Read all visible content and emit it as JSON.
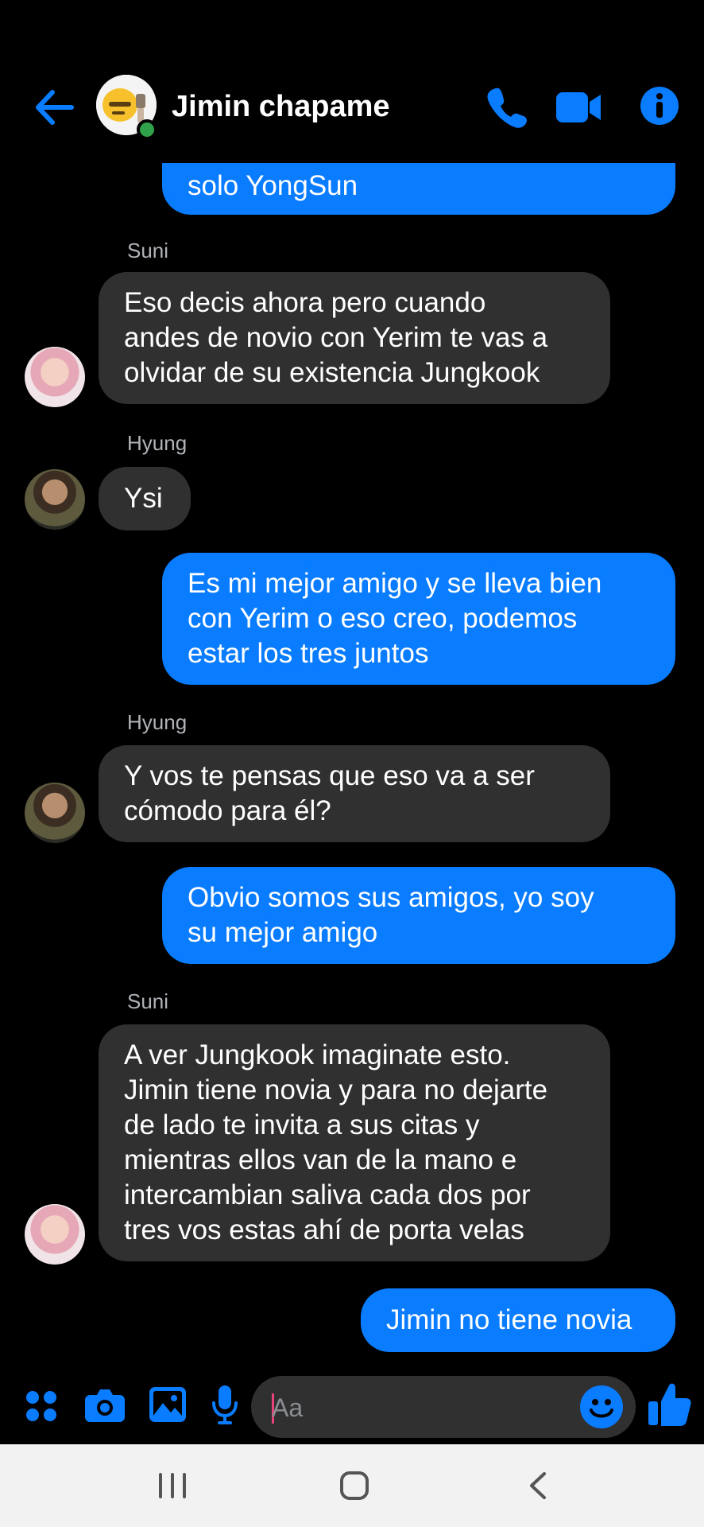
{
  "header": {
    "title": "Jimin chapame"
  },
  "messages": {
    "m0": {
      "text": "solo YongSun"
    },
    "m1": {
      "sender": "Suni",
      "lines": [
        "Eso decis ahora pero cuando",
        "andes de novio con Yerim te vas a",
        "olvidar de su existencia Jungkook"
      ]
    },
    "m2": {
      "sender": "Hyung",
      "text": "Ysi"
    },
    "m3": {
      "lines": [
        "Es mi mejor amigo y se lleva bien",
        "con Yerim o eso creo, podemos",
        "estar los tres juntos"
      ]
    },
    "m4": {
      "sender": "Hyung",
      "lines": [
        "Y vos te pensas que eso va a ser",
        "cómodo para él?"
      ]
    },
    "m5": {
      "lines": [
        "Obvio somos sus amigos, yo soy",
        "su mejor amigo"
      ]
    },
    "m6": {
      "sender": "Suni",
      "lines": [
        "A ver Jungkook imaginate esto.",
        "Jimin tiene novia y para no dejarte",
        "de lado te invita a sus citas y",
        "mientras ellos van de la mano e",
        "intercambian saliva cada dos por",
        "tres vos estas ahí de porta velas"
      ]
    },
    "m7": {
      "text": "Jimin no tiene novia"
    }
  },
  "composer": {
    "placeholder": "Aa"
  },
  "icons": {
    "back": "arrow-left-icon",
    "call": "phone-icon",
    "video": "video-camera-icon",
    "info": "info-icon",
    "menu": "four-dots-menu-icon",
    "camera": "camera-icon",
    "gallery": "image-icon",
    "mic": "microphone-icon",
    "emoji": "smiley-icon",
    "like": "thumbs-up-icon",
    "nav_recent": "recent-apps-icon",
    "nav_home": "home-icon",
    "nav_back": "chevron-left-icon"
  },
  "colors": {
    "accent": "#0a7cff",
    "incoming_bubble": "#303030",
    "background": "#000000",
    "online": "#31a24c"
  }
}
